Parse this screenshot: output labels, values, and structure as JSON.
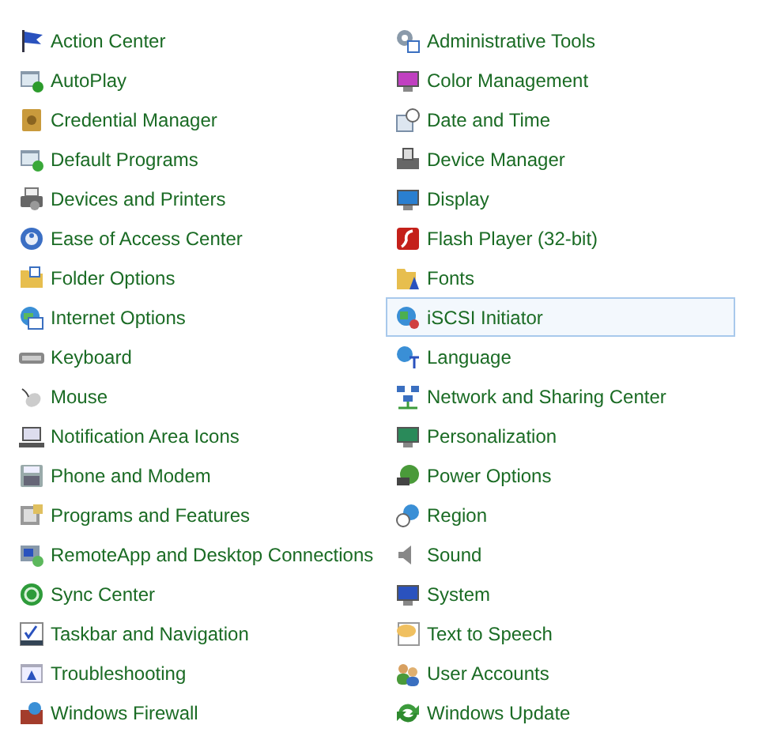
{
  "columns": [
    {
      "items": [
        {
          "label": "Action Center",
          "selected": false
        },
        {
          "label": "AutoPlay",
          "selected": false
        },
        {
          "label": "Credential Manager",
          "selected": false
        },
        {
          "label": "Default Programs",
          "selected": false
        },
        {
          "label": "Devices and Printers",
          "selected": false
        },
        {
          "label": "Ease of Access Center",
          "selected": false
        },
        {
          "label": "Folder Options",
          "selected": false
        },
        {
          "label": "Internet Options",
          "selected": false
        },
        {
          "label": "Keyboard",
          "selected": false
        },
        {
          "label": "Mouse",
          "selected": false
        },
        {
          "label": "Notification Area Icons",
          "selected": false
        },
        {
          "label": "Phone and Modem",
          "selected": false
        },
        {
          "label": "Programs and Features",
          "selected": false
        },
        {
          "label": "RemoteApp and Desktop Connections",
          "selected": false
        },
        {
          "label": "Sync Center",
          "selected": false
        },
        {
          "label": "Taskbar and Navigation",
          "selected": false
        },
        {
          "label": "Troubleshooting",
          "selected": false
        },
        {
          "label": "Windows Firewall",
          "selected": false
        }
      ]
    },
    {
      "items": [
        {
          "label": "Administrative Tools",
          "selected": false
        },
        {
          "label": "Color Management",
          "selected": false
        },
        {
          "label": "Date and Time",
          "selected": false
        },
        {
          "label": "Device Manager",
          "selected": false
        },
        {
          "label": "Display",
          "selected": false
        },
        {
          "label": "Flash Player (32-bit)",
          "selected": false
        },
        {
          "label": "Fonts",
          "selected": false
        },
        {
          "label": "iSCSI Initiator",
          "selected": true
        },
        {
          "label": "Language",
          "selected": false
        },
        {
          "label": "Network and Sharing Center",
          "selected": false
        },
        {
          "label": "Personalization",
          "selected": false
        },
        {
          "label": "Power Options",
          "selected": false
        },
        {
          "label": "Region",
          "selected": false
        },
        {
          "label": "Sound",
          "selected": false
        },
        {
          "label": "System",
          "selected": false
        },
        {
          "label": "Text to Speech",
          "selected": false
        },
        {
          "label": "User Accounts",
          "selected": false
        },
        {
          "label": "Windows Update",
          "selected": false
        }
      ]
    }
  ]
}
